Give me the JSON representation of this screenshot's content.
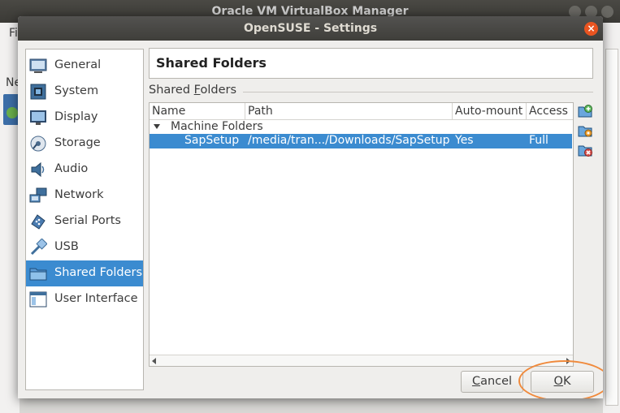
{
  "parent_window": {
    "title": "Oracle VM VirtualBox Manager",
    "menu_first": "Fi",
    "left_text": "Ne",
    "vm_badge": "64"
  },
  "dialog": {
    "title": "OpenSUSE - Settings",
    "close_symbol": "×"
  },
  "sidebar": {
    "items": [
      {
        "label": "General",
        "icon": "general-icon"
      },
      {
        "label": "System",
        "icon": "system-icon"
      },
      {
        "label": "Display",
        "icon": "display-icon"
      },
      {
        "label": "Storage",
        "icon": "storage-icon"
      },
      {
        "label": "Audio",
        "icon": "audio-icon"
      },
      {
        "label": "Network",
        "icon": "network-icon"
      },
      {
        "label": "Serial Ports",
        "icon": "serial-ports-icon"
      },
      {
        "label": "USB",
        "icon": "usb-icon"
      },
      {
        "label": "Shared Folders",
        "icon": "shared-folders-icon",
        "selected": true
      },
      {
        "label": "User Interface",
        "icon": "user-interface-icon"
      }
    ]
  },
  "page": {
    "title": "Shared Folders",
    "group_label_pre": "Shared ",
    "group_label_accel": "F",
    "group_label_post": "olders"
  },
  "table": {
    "columns": [
      "Name",
      "Path",
      "Auto-mount",
      "Access"
    ],
    "group": "Machine Folders",
    "rows": [
      {
        "name": "SapSetup",
        "path": "/media/tran.../Downloads/SapSetup",
        "auto_mount": "Yes",
        "access": "Full"
      }
    ]
  },
  "tools": {
    "add": "add-shared-folder-icon",
    "edit": "edit-shared-folder-icon",
    "remove": "remove-shared-folder-icon"
  },
  "buttons": {
    "cancel_accel": "C",
    "cancel_rest": "ancel",
    "ok_accel": "O",
    "ok_rest": "K"
  },
  "colors": {
    "selection": "#3b8bd0",
    "highlight_circle": "#f08a3c",
    "close_button": "#e95420"
  }
}
